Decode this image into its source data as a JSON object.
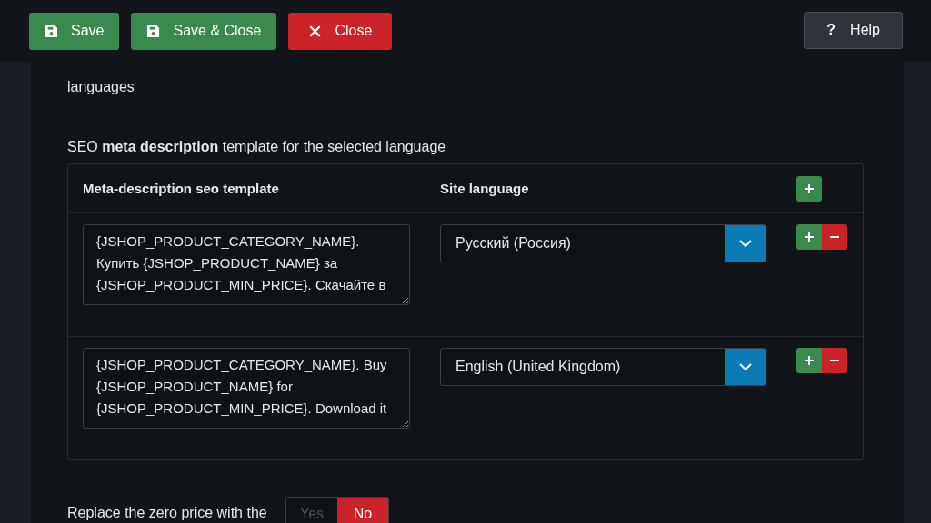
{
  "toolbar": {
    "buttons": [
      {
        "label": "Save",
        "kind": "save"
      },
      {
        "label": "Save & Close",
        "kind": "save"
      },
      {
        "label": "Close",
        "kind": "close"
      }
    ],
    "help": {
      "icon": "?",
      "label": "Help"
    }
  },
  "language_hint": "languages",
  "section_title": "SEO **meta description** template for the selected language",
  "table": {
    "columns": [
      "Meta-description seo template",
      "Site language"
    ],
    "rows": [
      {
        "template": "{JSHOP_PRODUCT_CATEGORY_NAME}. Купить {JSHOP_PRODUCT_NAME} за {JSHOP_PRODUCT_MIN_PRICE}. Скачайте в",
        "language": "Русский (Россия)"
      },
      {
        "template": "{JSHOP_PRODUCT_CATEGORY_NAME}. Buy {JSHOP_PRODUCT_NAME} for {JSHOP_PRODUCT_MIN_PRICE}. Download it",
        "language": "English (United Kingdom)"
      }
    ]
  },
  "zero_price": {
    "label": "Replace the zero price with the",
    "options": [
      {
        "label": "Yes",
        "selected": false
      },
      {
        "label": "No",
        "selected": true
      }
    ]
  }
}
